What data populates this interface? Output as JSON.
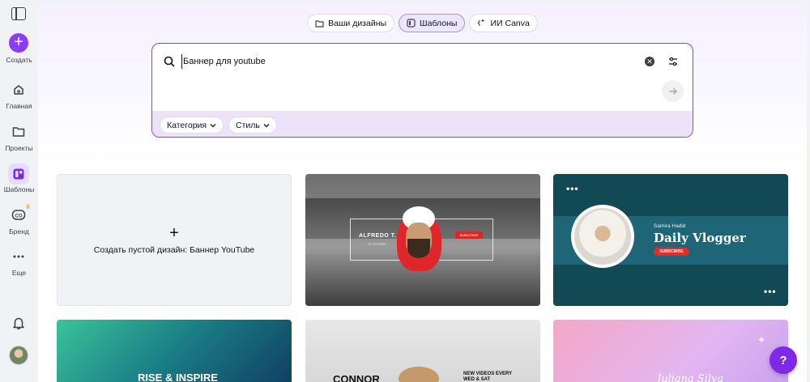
{
  "sidebar": {
    "create_label": "Создать",
    "items": [
      {
        "label": "Главная"
      },
      {
        "label": "Проекты"
      },
      {
        "label": "Шаблоны"
      },
      {
        "label": "Бренд"
      },
      {
        "label": "Еще"
      }
    ]
  },
  "tabs": [
    {
      "label": "Ваши дизайны"
    },
    {
      "label": "Шаблоны"
    },
    {
      "label": "ИИ Canva"
    }
  ],
  "search": {
    "value": "Баннер для youtube",
    "filters": [
      {
        "label": "Категория"
      },
      {
        "label": "Стиль"
      }
    ]
  },
  "cards": {
    "blank_label": "Создать пустой дизайн: Баннер YouTube",
    "t1": {
      "name": "ALFREDO T.",
      "subtitle": "VLOGGER",
      "button": "SUBSCRIBE"
    },
    "t2": {
      "name": "Samira Hadid",
      "title": "Daily Vlogger",
      "button": "SUBSCRIBE"
    },
    "t3": {
      "title": "RISE & INSPIRE"
    },
    "t4": {
      "title": "CONNOR",
      "side_text": "NEW VIDEOS EVERY WED & SAT"
    },
    "t5": {
      "title": "Juliana Silva"
    }
  },
  "help_label": "?",
  "colors": {
    "accent": "#8b3dff",
    "active_bg": "#ede6ff",
    "search_bottom": "#ece3fb"
  }
}
